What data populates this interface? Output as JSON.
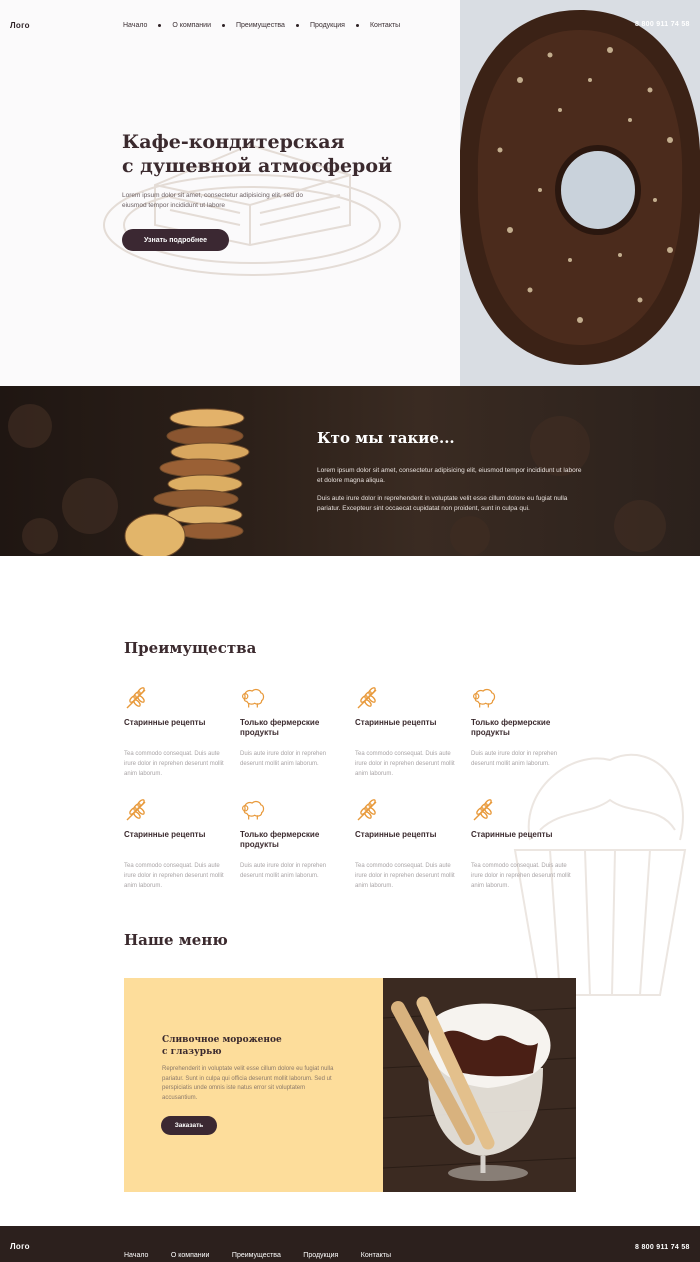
{
  "header": {
    "logo": "Лого",
    "nav": [
      "Начало",
      "О компании",
      "Преимущества",
      "Продукция",
      "Контакты"
    ],
    "phone": "8 800 911 74 58"
  },
  "hero": {
    "title_line1": "Кафе-кондитерская",
    "title_line2": "с душевной атмосферой",
    "text": "Lorem ipsum dolor sit amet, consectetur adipisicing elit, sed do eiusmod tempor incididunt ut labore",
    "button": "Узнать подробнее"
  },
  "about": {
    "title": "Кто мы такие...",
    "p1": "Lorem ipsum dolor sit amet, consectetur adipisicing elit, eiusmod tempor incididunt ut labore et dolore magna aliqua.",
    "p2": "Duis aute irure dolor in reprehenderit in voluptate velit esse cillum dolore eu fugiat nulla pariatur. Excepteur sint occaecat cupidatat non proident, sunt in culpa qui."
  },
  "advantages": {
    "title": "Преимущества",
    "items": [
      {
        "icon": "wheat-icon",
        "title": "Старинные рецепты",
        "text": "Tea commodo consequat. Duis aute irure dolor in reprehen deserunt mollit anim laborum."
      },
      {
        "icon": "sheep-icon",
        "title": "Только фермерские продукты",
        "text": "Duis aute irure dolor in reprehen deserunt mollit anim laborum."
      },
      {
        "icon": "wheat-icon",
        "title": "Старинные рецепты",
        "text": "Tea commodo consequat. Duis aute irure dolor in reprehen deserunt mollit anim laborum."
      },
      {
        "icon": "sheep-icon",
        "title": "Только фермерские продукты",
        "text": "Duis aute irure dolor in reprehen deserunt mollit anim laborum."
      },
      {
        "icon": "wheat-icon",
        "title": "Старинные рецепты",
        "text": "Tea commodo consequat. Duis aute irure dolor in reprehen deserunt mollit anim laborum."
      },
      {
        "icon": "sheep-icon",
        "title": "Только фермерские продукты",
        "text": "Duis aute irure dolor in reprehen deserunt mollit anim laborum."
      },
      {
        "icon": "wheat-icon",
        "title": "Старинные рецепты",
        "text": "Tea commodo consequat. Duis aute irure dolor in reprehen deserunt mollit anim laborum."
      },
      {
        "icon": "wheat-icon",
        "title": "Старинные рецепты",
        "text": "Tea commodo consequat. Duis aute irure dolor in reprehen deserunt mollit anim laborum."
      }
    ]
  },
  "menu": {
    "title": "Наше меню",
    "item_title_line1": "Сливочное мороженое",
    "item_title_line2": "с глазурью",
    "item_text": "Reprehenderit in voluptate velit esse cillum dolore eu fugiat nulla pariatur. Sunt in culpa qui officia deserunt mollit laborum. Sed ut perspiciatis unde omnis iste natus error sit voluptatem accusantium.",
    "button": "Заказать"
  },
  "footer": {
    "logo": "Лого",
    "nav": [
      "Начало",
      "О компании",
      "Преимущества",
      "Продукция",
      "Контакты"
    ],
    "phone": "8 800 911 74 58"
  },
  "colors": {
    "accent_dark": "#3b2832",
    "icon_orange": "#e89a3c",
    "menu_card": "#fddd9b",
    "footer_bg": "#2c201d"
  }
}
